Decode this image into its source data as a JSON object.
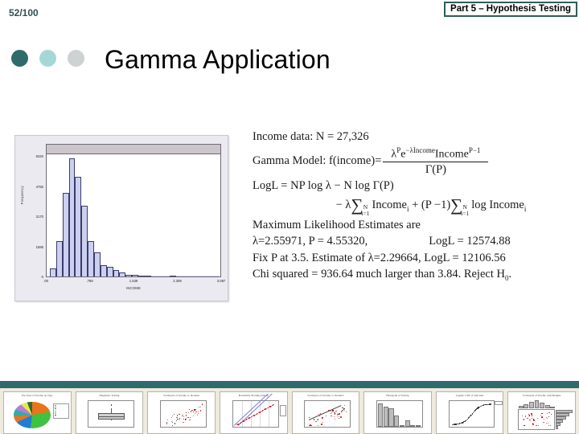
{
  "page": {
    "counter": "52/100"
  },
  "header": {
    "badge": "Part 5 – Hypothesis Testing"
  },
  "title": "Gamma Application",
  "decor_dots": [
    {
      "name": "dot-dark-teal",
      "color": "#2f6b6b"
    },
    {
      "name": "dot-light-teal",
      "color": "#a6d7d7"
    },
    {
      "name": "dot-gray",
      "color": "#cfd2d2"
    }
  ],
  "chart_data": {
    "type": "bar",
    "title": "",
    "xlabel": "INCOME",
    "ylabel": "Frequency",
    "categories": [
      ".00",
      ".769",
      "1.539",
      "2.309",
      "3.087"
    ],
    "xtick_positions": [
      0,
      25,
      50,
      75,
      100
    ],
    "ytick_labels": [
      "6340",
      "4755",
      "3170",
      "1585",
      "0"
    ],
    "ylim": [
      0,
      6340
    ],
    "grid": false,
    "legend": null,
    "bin_values": [
      380,
      1720,
      4050,
      5720,
      4820,
      3430,
      1720,
      1150,
      560,
      470,
      300,
      180,
      95,
      60,
      40,
      25,
      18,
      12,
      8,
      6,
      40,
      4,
      3,
      2,
      2,
      1,
      1,
      1,
      1,
      1
    ],
    "bar_fill": "#ccd0f0",
    "bar_border": "#3b3b6b"
  },
  "equations": {
    "income_data": "Income data: N = 27,326",
    "gamma_model_label": "Gamma Model: f(income)=",
    "gamma_numerator_lambda": "λ",
    "gamma_numerator_lambda_sup": "P",
    "gamma_numerator_e": "e",
    "gamma_numerator_e_sup": "−λIncome",
    "gamma_numerator_income": "Income",
    "gamma_numerator_income_sup": "P−1",
    "gamma_denominator": "Γ(P)",
    "logl_line": "LogL = NP log λ − N log Γ(P)",
    "sum_prefix": "− λ",
    "sum_upper": "N",
    "sum_lower": "i=1",
    "sum_mid": "Income",
    "sum_mid_sub": "i",
    "sum_plus": "+ (P −1)",
    "sum_upper2": "N",
    "sum_lower2": "i=1",
    "sum_tail": "log Income",
    "sum_tail_sub": "i",
    "mle_header": "Maximum Likelihood Estimates are",
    "mle_values": "λ=2.55971, P = 4.55320,",
    "mle_logl": "LogL = 12574.88",
    "fix_line": "Fix P at 3.5.  Estimate of λ=2.29664, LogL = 12106.56",
    "chi_line_a": "Chi squared = 936.64 much larger than 3.84.  Reject H",
    "chi_line_sub": "0",
    "chi_line_b": "."
  },
  "filmstrip": {
    "band_color": "#2f6b6b",
    "background": "#efeade",
    "thumbs": [
      {
        "name": "thumb-pie-chart",
        "title": "Pie Chart of Income on Type",
        "kind": "pie"
      },
      {
        "name": "thumb-boxplot",
        "title": "Diagnostic Testing",
        "kind": "box"
      },
      {
        "name": "thumb-scatter-1",
        "title": "Scatterplot of Income vs Income2",
        "kind": "scatter"
      },
      {
        "name": "thumb-pp-plot",
        "title": "Probability Plotting Testing",
        "kind": "pp"
      },
      {
        "name": "thumb-scatter-2",
        "title": "Scatterplot of Income vs Income3",
        "kind": "scatter"
      },
      {
        "name": "thumb-histogram",
        "title": "Histogram of Testing",
        "kind": "hist"
      },
      {
        "name": "thumb-logistic",
        "title": "Logistic CDF of Outcome",
        "kind": "cdf"
      },
      {
        "name": "thumb-marginal",
        "title": "Scatterplot of Income with Margins",
        "kind": "marginal"
      }
    ]
  }
}
